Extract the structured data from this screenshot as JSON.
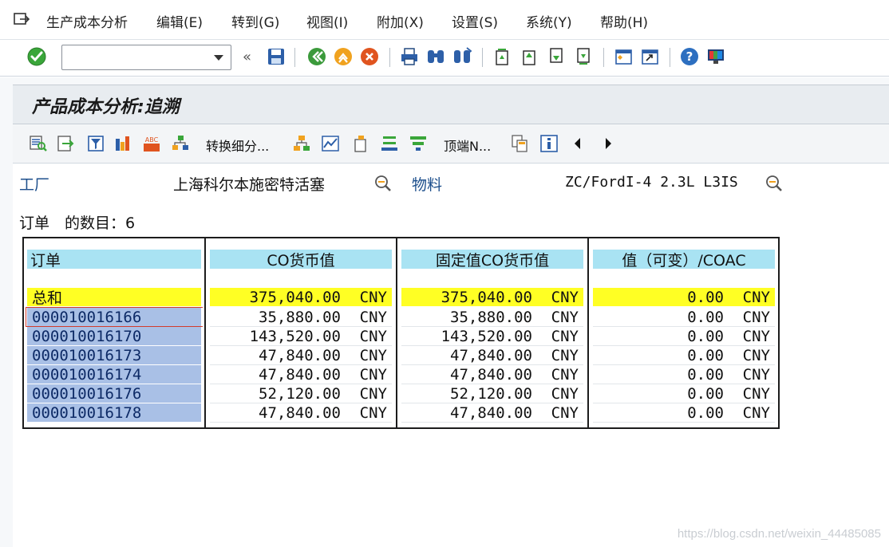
{
  "menu": {
    "items": [
      "生产成本分析",
      "编辑(E)",
      "转到(G)",
      "视图(I)",
      "附加(X)",
      "设置(S)",
      "系统(Y)",
      "帮助(H)"
    ]
  },
  "toolbar": {
    "command_field_value": "",
    "icons": [
      "enter-check-icon",
      "command-field",
      "collapse-icon",
      "save-icon",
      "back-icon",
      "exit-icon",
      "cancel-icon",
      "print-icon",
      "find-icon",
      "find-next-icon",
      "first-page-icon",
      "previous-page-icon",
      "next-page-icon",
      "last-page-icon",
      "create-session-icon",
      "shortcut-icon",
      "help-icon",
      "customize-layout-icon"
    ]
  },
  "screen": {
    "title": "产品成本分析:追溯"
  },
  "app_toolbar": {
    "switch_detail_label": "转换细分...",
    "top_n_label": "顶端N..."
  },
  "header_fields": {
    "plant_label": "工厂",
    "plant_value": "上海科尔本施密特活塞",
    "material_label": "物料",
    "material_value": "ZC/FordI-4 2.3L L3IS"
  },
  "count_label": "订单　的数目：6",
  "table": {
    "columns": [
      "订单",
      "CO货币值",
      "固定值CO货币值",
      "值（可变）/COAC"
    ],
    "total": {
      "label": "总和",
      "co_value": "375,040.00",
      "fixed_value": "375,040.00",
      "variable_value": "0.00",
      "currency": "CNY"
    },
    "rows": [
      {
        "order": "000010016166",
        "co_value": "35,880.00",
        "fixed_value": "35,880.00",
        "variable_value": "0.00",
        "currency": "CNY"
      },
      {
        "order": "000010016170",
        "co_value": "143,520.00",
        "fixed_value": "143,520.00",
        "variable_value": "0.00",
        "currency": "CNY"
      },
      {
        "order": "000010016173",
        "co_value": "47,840.00",
        "fixed_value": "47,840.00",
        "variable_value": "0.00",
        "currency": "CNY"
      },
      {
        "order": "000010016174",
        "co_value": "47,840.00",
        "fixed_value": "47,840.00",
        "variable_value": "0.00",
        "currency": "CNY"
      },
      {
        "order": "000010016176",
        "co_value": "52,120.00",
        "fixed_value": "52,120.00",
        "variable_value": "0.00",
        "currency": "CNY"
      },
      {
        "order": "000010016178",
        "co_value": "47,840.00",
        "fixed_value": "47,840.00",
        "variable_value": "0.00",
        "currency": "CNY"
      }
    ]
  },
  "watermark": "https://blog.csdn.net/weixin_44485085",
  "colors": {
    "header_cell": "#a9e3f3",
    "total_row": "#ffff24",
    "order_cell": "#a9c0e6",
    "label_blue": "#1d4f8c"
  }
}
